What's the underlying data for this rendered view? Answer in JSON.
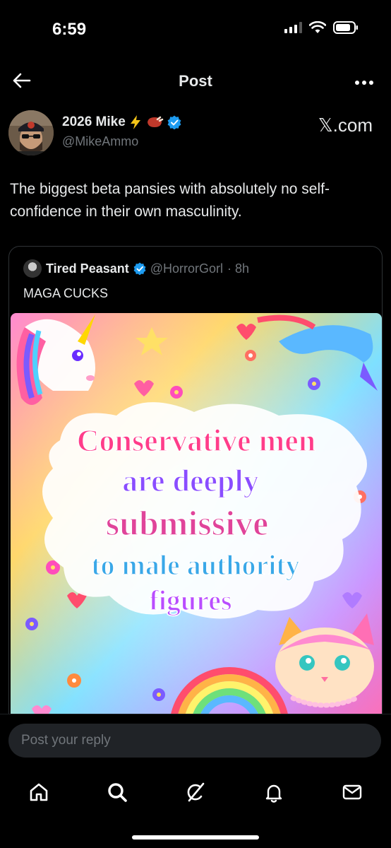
{
  "status_bar": {
    "time": "6:59"
  },
  "header": {
    "title": "Post"
  },
  "author": {
    "name": "2026 Mike",
    "handle": "@MikeAmmo",
    "site": "𝕏.com",
    "verified_color": "#1d9bf0"
  },
  "post": {
    "text": "The biggest beta pansies with absolutely no self-confidence in their own masculinity."
  },
  "quote": {
    "name": "Tired Peasant",
    "handle": "@HorrorGorl",
    "time": "· 8h",
    "text": "MAGA CUCKS",
    "image_lines": [
      "Conservative men",
      "are deeply",
      "submissive",
      "to male authority",
      "figures"
    ]
  },
  "reply": {
    "placeholder": "Post your reply"
  },
  "tabs": [
    "home-icon",
    "search-icon",
    "grok-icon",
    "notifications-icon",
    "messages-icon"
  ]
}
